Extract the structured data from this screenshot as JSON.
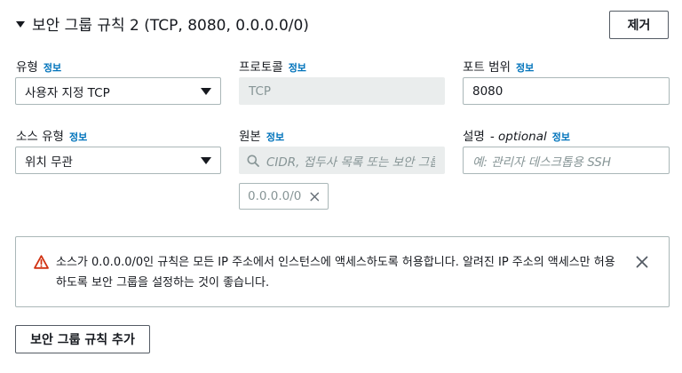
{
  "header": {
    "title": "보안 그룹 규칙 2 (TCP, 8080, 0.0.0.0/0)",
    "remove_label": "제거"
  },
  "info_label": "정보",
  "fields": {
    "type": {
      "label": "유형",
      "value": "사용자 지정 TCP"
    },
    "protocol": {
      "label": "프로토콜",
      "value": "TCP"
    },
    "port_range": {
      "label": "포트 범위",
      "value": "8080"
    },
    "source_type": {
      "label": "소스 유형",
      "value": "위치 무관"
    },
    "source": {
      "label": "원본",
      "placeholder": "CIDR, 접두사 목록 또는 보안 그룹",
      "token": "0.0.0.0/0"
    },
    "description": {
      "label": "설명",
      "optional": "- optional",
      "placeholder": "예: 관리자 데스크톱용 SSH"
    }
  },
  "alert": {
    "text": "소스가 0.0.0.0/0인 규칙은 모든 IP 주소에서 인스턴스에 액세스하도록 허용합니다. 알려진 IP 주소의 액세스만 허용하도록 보안 그룹을 설정하는 것이 좋습니다.",
    "icon": "warning-icon",
    "color": "#d13212"
  },
  "add_rule_label": "보안 그룹 규칙 추가",
  "colors": {
    "link": "#0073bb",
    "border": "#aab7b8",
    "disabled_bg": "#eaeded"
  }
}
